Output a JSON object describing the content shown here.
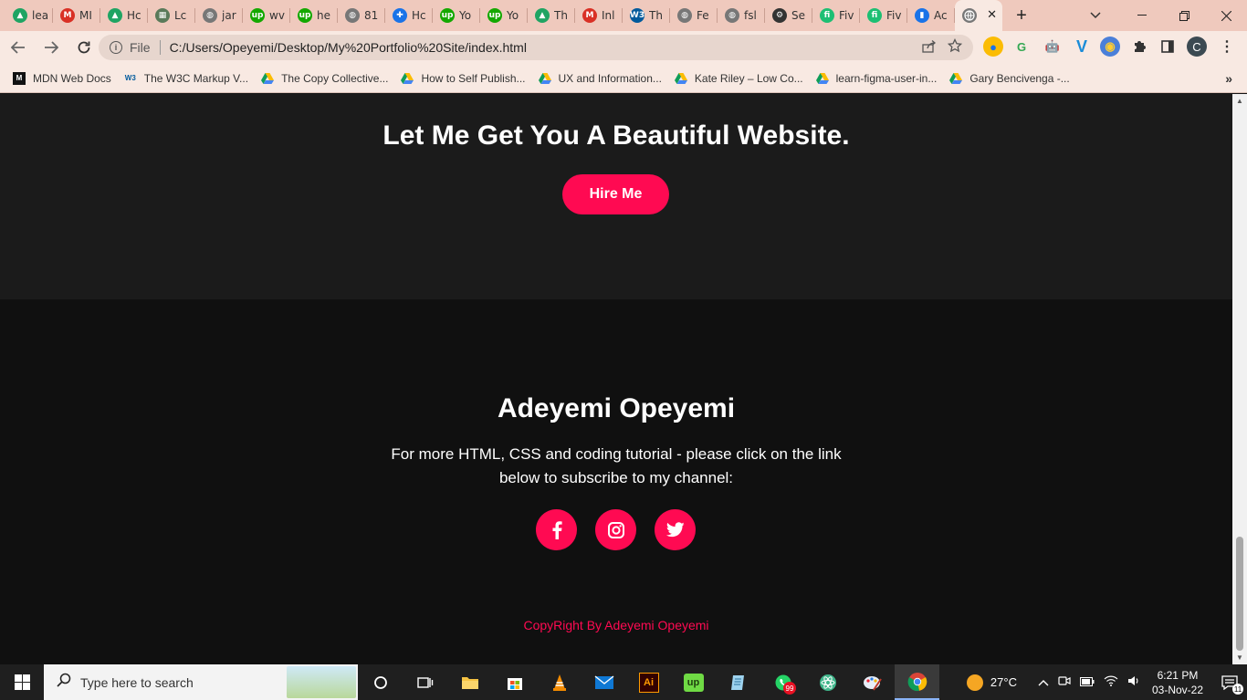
{
  "browser": {
    "tabs": [
      {
        "title": "lea",
        "icon": "google-drive-icon",
        "color": "#1fa463"
      },
      {
        "title": "MI",
        "icon": "gmail-icon",
        "color": "#d93025"
      },
      {
        "title": "Hc",
        "icon": "google-drive-icon",
        "color": "#1fa463"
      },
      {
        "title": "Lc",
        "icon": "site-icon",
        "color": "#5a7a5a"
      },
      {
        "title": "jar",
        "icon": "globe-icon",
        "color": "#777777"
      },
      {
        "title": "wv",
        "icon": "upwork-icon",
        "color": "#14a800"
      },
      {
        "title": "he",
        "icon": "upwork-icon",
        "color": "#14a800"
      },
      {
        "title": "81",
        "icon": "globe-icon",
        "color": "#777777"
      },
      {
        "title": "Hc",
        "icon": "plus-cross-icon",
        "color": "#1a73e8"
      },
      {
        "title": "Yo",
        "icon": "upwork-icon",
        "color": "#14a800"
      },
      {
        "title": "Yo",
        "icon": "upwork-icon",
        "color": "#14a800"
      },
      {
        "title": "Th",
        "icon": "google-drive-icon",
        "color": "#1fa463"
      },
      {
        "title": "Inl",
        "icon": "gmail-icon",
        "color": "#d93025"
      },
      {
        "title": "Th",
        "icon": "w3c-icon",
        "color": "#005a9c"
      },
      {
        "title": "Fe",
        "icon": "globe-icon",
        "color": "#777777"
      },
      {
        "title": "fsl",
        "icon": "globe-icon",
        "color": "#777777"
      },
      {
        "title": "Se",
        "icon": "settings-gear-icon",
        "color": "#333333"
      },
      {
        "title": "Fiv",
        "icon": "fiverr-icon",
        "color": "#1dbf73"
      },
      {
        "title": "Fiv",
        "icon": "fiverr-icon",
        "color": "#1dbf73"
      },
      {
        "title": "Ac",
        "icon": "bookmark-icon",
        "color": "#1a73e8"
      }
    ],
    "active_tab_title": "",
    "new_tab_label": "+",
    "address": {
      "scheme_label": "File",
      "url": "C:/Users/Opeyemi/Desktop/My%20Portfolio%20Site/index.html"
    },
    "extension_profile_letter": "C",
    "bookmarks": [
      {
        "label": "MDN Web Docs",
        "icon": "mdn-icon"
      },
      {
        "label": "The W3C Markup V...",
        "icon": "w3c-icon"
      },
      {
        "label": "The Copy Collective...",
        "icon": "google-drive-icon"
      },
      {
        "label": "How to Self Publish...",
        "icon": "google-drive-icon"
      },
      {
        "label": "UX and Information...",
        "icon": "google-drive-icon"
      },
      {
        "label": "Kate Riley – Low Co...",
        "icon": "google-drive-icon"
      },
      {
        "label": "learn-figma-user-in...",
        "icon": "google-drive-icon"
      },
      {
        "label": "Gary Bencivenga -...",
        "icon": "google-drive-icon"
      }
    ]
  },
  "page": {
    "cta": {
      "heading": "Let Me Get You A Beautiful Website.",
      "button_label": "Hire Me"
    },
    "footer": {
      "name": "Adeyemi Opeyemi",
      "description": "For more HTML, CSS and coding tutorial - please click on the link below to subscribe to my channel:",
      "socials": [
        {
          "name": "facebook",
          "icon": "facebook-icon"
        },
        {
          "name": "instagram",
          "icon": "instagram-icon"
        },
        {
          "name": "twitter",
          "icon": "twitter-icon"
        }
      ],
      "copyright": "CopyRight By Adeyemi Opeyemi"
    },
    "accent_color": "#ff0a52"
  },
  "taskbar": {
    "search_placeholder": "Type here to search",
    "weather": "27°C",
    "time": "6:21 PM",
    "date": "03-Nov-22",
    "whatsapp_badge": "99",
    "notification_count": "11"
  }
}
